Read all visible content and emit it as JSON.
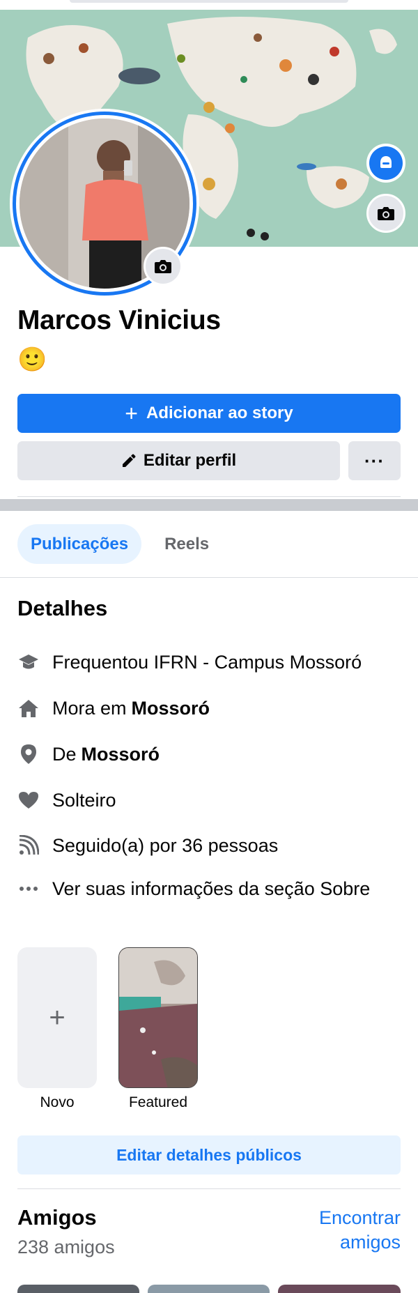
{
  "profile": {
    "name": "Marcos Vinicius",
    "emoji": "🙂"
  },
  "buttons": {
    "add_story": "Adicionar ao story",
    "add_story_plus": "+",
    "edit_profile": "Editar perfil",
    "more": "···",
    "edit_public_details": "Editar detalhes públicos"
  },
  "tabs": [
    {
      "label": "Publicações",
      "active": true
    },
    {
      "label": "Reels",
      "active": false
    }
  ],
  "details": {
    "title": "Detalhes",
    "items": [
      {
        "icon": "graduation-cap-icon",
        "text": "Frequentou IFRN - Campus Mossoró",
        "bold": ""
      },
      {
        "icon": "home-icon",
        "text": "Mora em",
        "bold": "Mossoró"
      },
      {
        "icon": "location-pin-icon",
        "text": "De",
        "bold": "Mossoró"
      },
      {
        "icon": "heart-icon",
        "text": "Solteiro",
        "bold": ""
      },
      {
        "icon": "rss-feed-icon",
        "text": "Seguido(a) por 36 pessoas",
        "bold": ""
      },
      {
        "icon": "more-dots-icon",
        "text": "Ver suas informações da seção Sobre",
        "bold": ""
      }
    ]
  },
  "featured": {
    "new_plus": "+",
    "new_label": "Novo",
    "item_label": "Featured"
  },
  "friends": {
    "title": "Amigos",
    "count": "238 amigos",
    "find": "Encontrar amigos"
  },
  "colors": {
    "accent": "#1877f2",
    "accent_light": "#e7f3ff",
    "button_gray": "#e4e6eb",
    "muted_text": "#65676b"
  }
}
